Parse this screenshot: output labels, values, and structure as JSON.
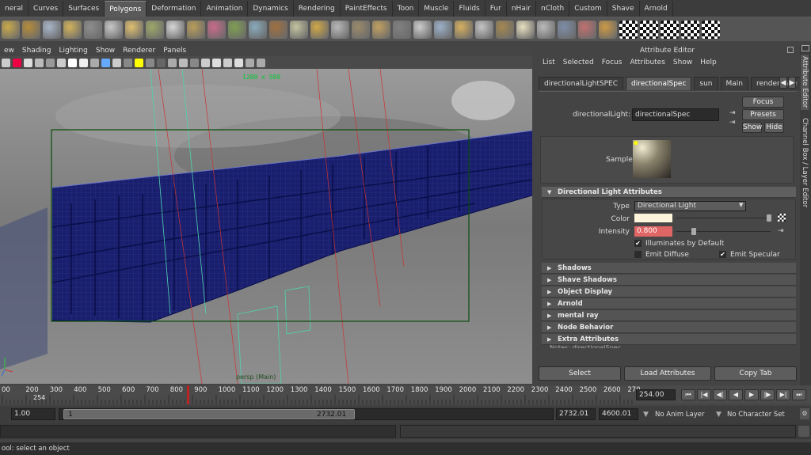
{
  "shelf_tabs": [
    "neral",
    "Curves",
    "Surfaces",
    "Polygons",
    "Deformation",
    "Animation",
    "Dynamics",
    "Rendering",
    "PaintEffects",
    "Toon",
    "Muscle",
    "Fluids",
    "Fur",
    "nHair",
    "nCloth",
    "Custom",
    "Shave",
    "Arnold"
  ],
  "shelf_active": "Polygons",
  "shelf_icons": [
    "cube-icon",
    "cylinder-icon",
    "cone-icon",
    "plane-icon",
    "torus-icon",
    "pyramid-icon",
    "pipe-icon",
    "helix-icon",
    "soccer-icon",
    "extrude-icon",
    "bridge-icon",
    "append-icon",
    "split-icon",
    "insert-loop-icon",
    "multi-cut-icon",
    "merge-icon",
    "combine-icon",
    "separate-icon",
    "smooth-icon",
    "mirror-icon",
    "bevel-icon",
    "wedge-icon",
    "poke-icon",
    "chamfer-icon",
    "sculpt-icon",
    "reduce-icon",
    "triangulate-icon",
    "quadrangulate-icon",
    "uv-editor-icon",
    "planar-map-icon",
    "checker-icon",
    "checker-icon",
    "checker-icon",
    "checker-icon",
    "checker-icon"
  ],
  "viewport_menu": [
    "ew",
    "Shading",
    "Lighting",
    "Show",
    "Renderer",
    "Panels"
  ],
  "viewport": {
    "resolution": "1280 x 589",
    "camera": "persp (Main)"
  },
  "attribute_editor": {
    "title": "Attribute Editor",
    "menu": [
      "List",
      "Selected",
      "Focus",
      "Attributes",
      "Show",
      "Help"
    ],
    "tabs": [
      "directionalLightSPEC",
      "directionalSpec",
      "sun",
      "Main",
      "renderLaye"
    ],
    "active_tab": "directionalSpec",
    "node_label": "directionalLight:",
    "node_value": "directionalSpec",
    "focus": "Focus",
    "presets": "Presets",
    "show": "Show",
    "hide": "Hide",
    "sample_label": "Sample",
    "section_open": "Directional Light Attributes",
    "type_label": "Type",
    "type_value": "Directional Light",
    "color_label": "Color",
    "intensity_label": "Intensity",
    "intensity_value": "0.800",
    "illuminates": "Illuminates by Default",
    "emit_diffuse": "Emit Diffuse",
    "emit_specular": "Emit Specular",
    "sections": [
      "Shadows",
      "Shave Shadows",
      "Object Display",
      "Arnold",
      "mental ray",
      "Node Behavior",
      "Extra Attributes"
    ],
    "notes": "Notes:  directionalSpec",
    "bottom_buttons": [
      "Select",
      "Load Attributes",
      "Copy Tab"
    ],
    "color_value": "#fff5dd",
    "intensity_color": "#e06565"
  },
  "side_tabs": [
    "Attribute Editor",
    "Channel Box / Layer Editor"
  ],
  "timeline": {
    "ticks": [
      "00",
      "200",
      "300",
      "400",
      "500",
      "600",
      "700",
      "800",
      "900",
      "1000",
      "1100",
      "1200",
      "1300",
      "1400",
      "1500",
      "1600",
      "1700",
      "1800",
      "1900",
      "2000",
      "2100",
      "2200",
      "2300",
      "2400",
      "2500",
      "2600",
      "270"
    ],
    "current_frame": "254",
    "current_field": "254.00"
  },
  "range": {
    "start": "1.00",
    "inner_start": "1",
    "inner_end": "2732.01",
    "end": "2732.01",
    "max": "4600.01",
    "anim_layer": "No Anim Layer",
    "char_set": "No Character Set"
  },
  "help_line": "ool: select an object"
}
